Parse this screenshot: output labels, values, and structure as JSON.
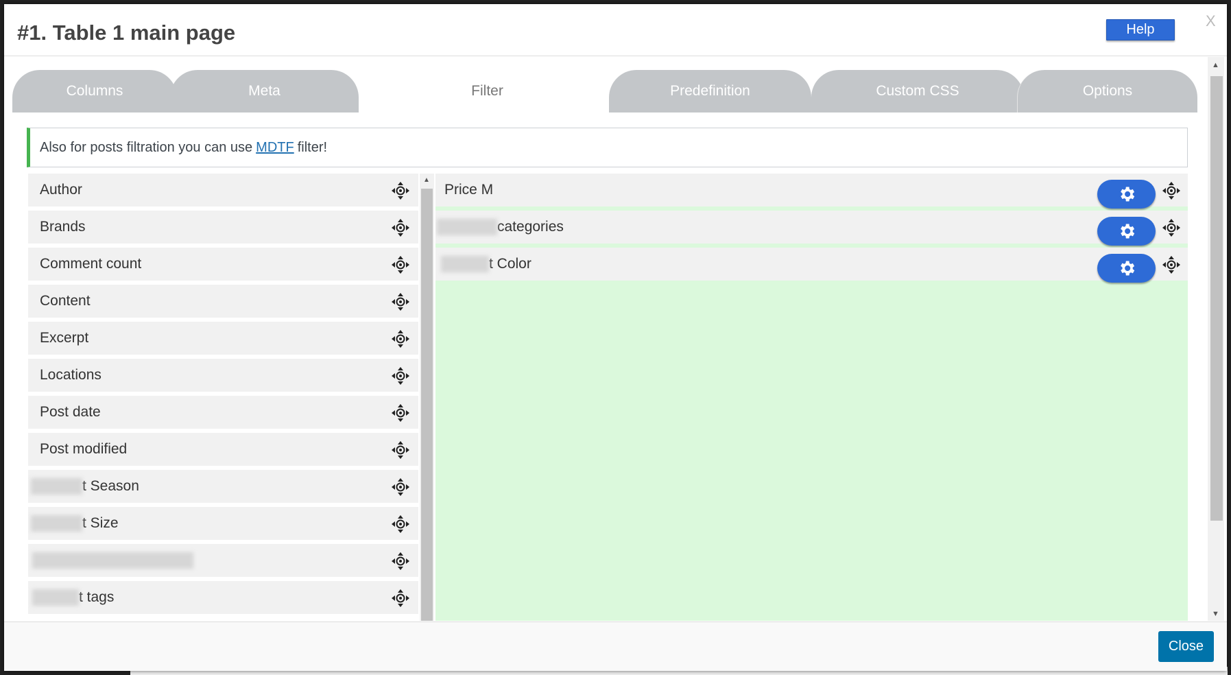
{
  "modal": {
    "title": "#1. Table 1 main page",
    "help_label": "Help",
    "close_x": "X",
    "close_label": "Close"
  },
  "tabs": [
    {
      "label": "Columns",
      "active": false
    },
    {
      "label": "Meta",
      "active": false
    },
    {
      "label": "Filter",
      "active": true
    },
    {
      "label": "Predefinition",
      "active": false
    },
    {
      "label": "Custom CSS",
      "active": false
    },
    {
      "label": "Options",
      "active": false
    }
  ],
  "notice": {
    "prefix": "Also for posts filtration you can use",
    "link": "MDTF",
    "suffix": "filter!",
    "accent_color": "#46b450"
  },
  "available_fields": [
    {
      "label": "Author"
    },
    {
      "label": "Brands"
    },
    {
      "label": "Comment count"
    },
    {
      "label": "Content"
    },
    {
      "label": "Excerpt"
    },
    {
      "label": "Locations"
    },
    {
      "label": "Post date"
    },
    {
      "label": "Post modified"
    },
    {
      "label": "t Season"
    },
    {
      "label": "t Size"
    },
    {
      "label": ""
    },
    {
      "label": "t tags"
    }
  ],
  "selected_fields": [
    {
      "label": "Price M"
    },
    {
      "label": "categories"
    },
    {
      "label": "t Color"
    }
  ],
  "colors": {
    "accent": "#2e6bd6",
    "drop_zone": "#dbf9dc",
    "tab_inactive": "#c3c6c9",
    "close_button": "#0073aa"
  },
  "icons": {
    "move": "move-arrows-icon",
    "settings": "gear-icon"
  }
}
